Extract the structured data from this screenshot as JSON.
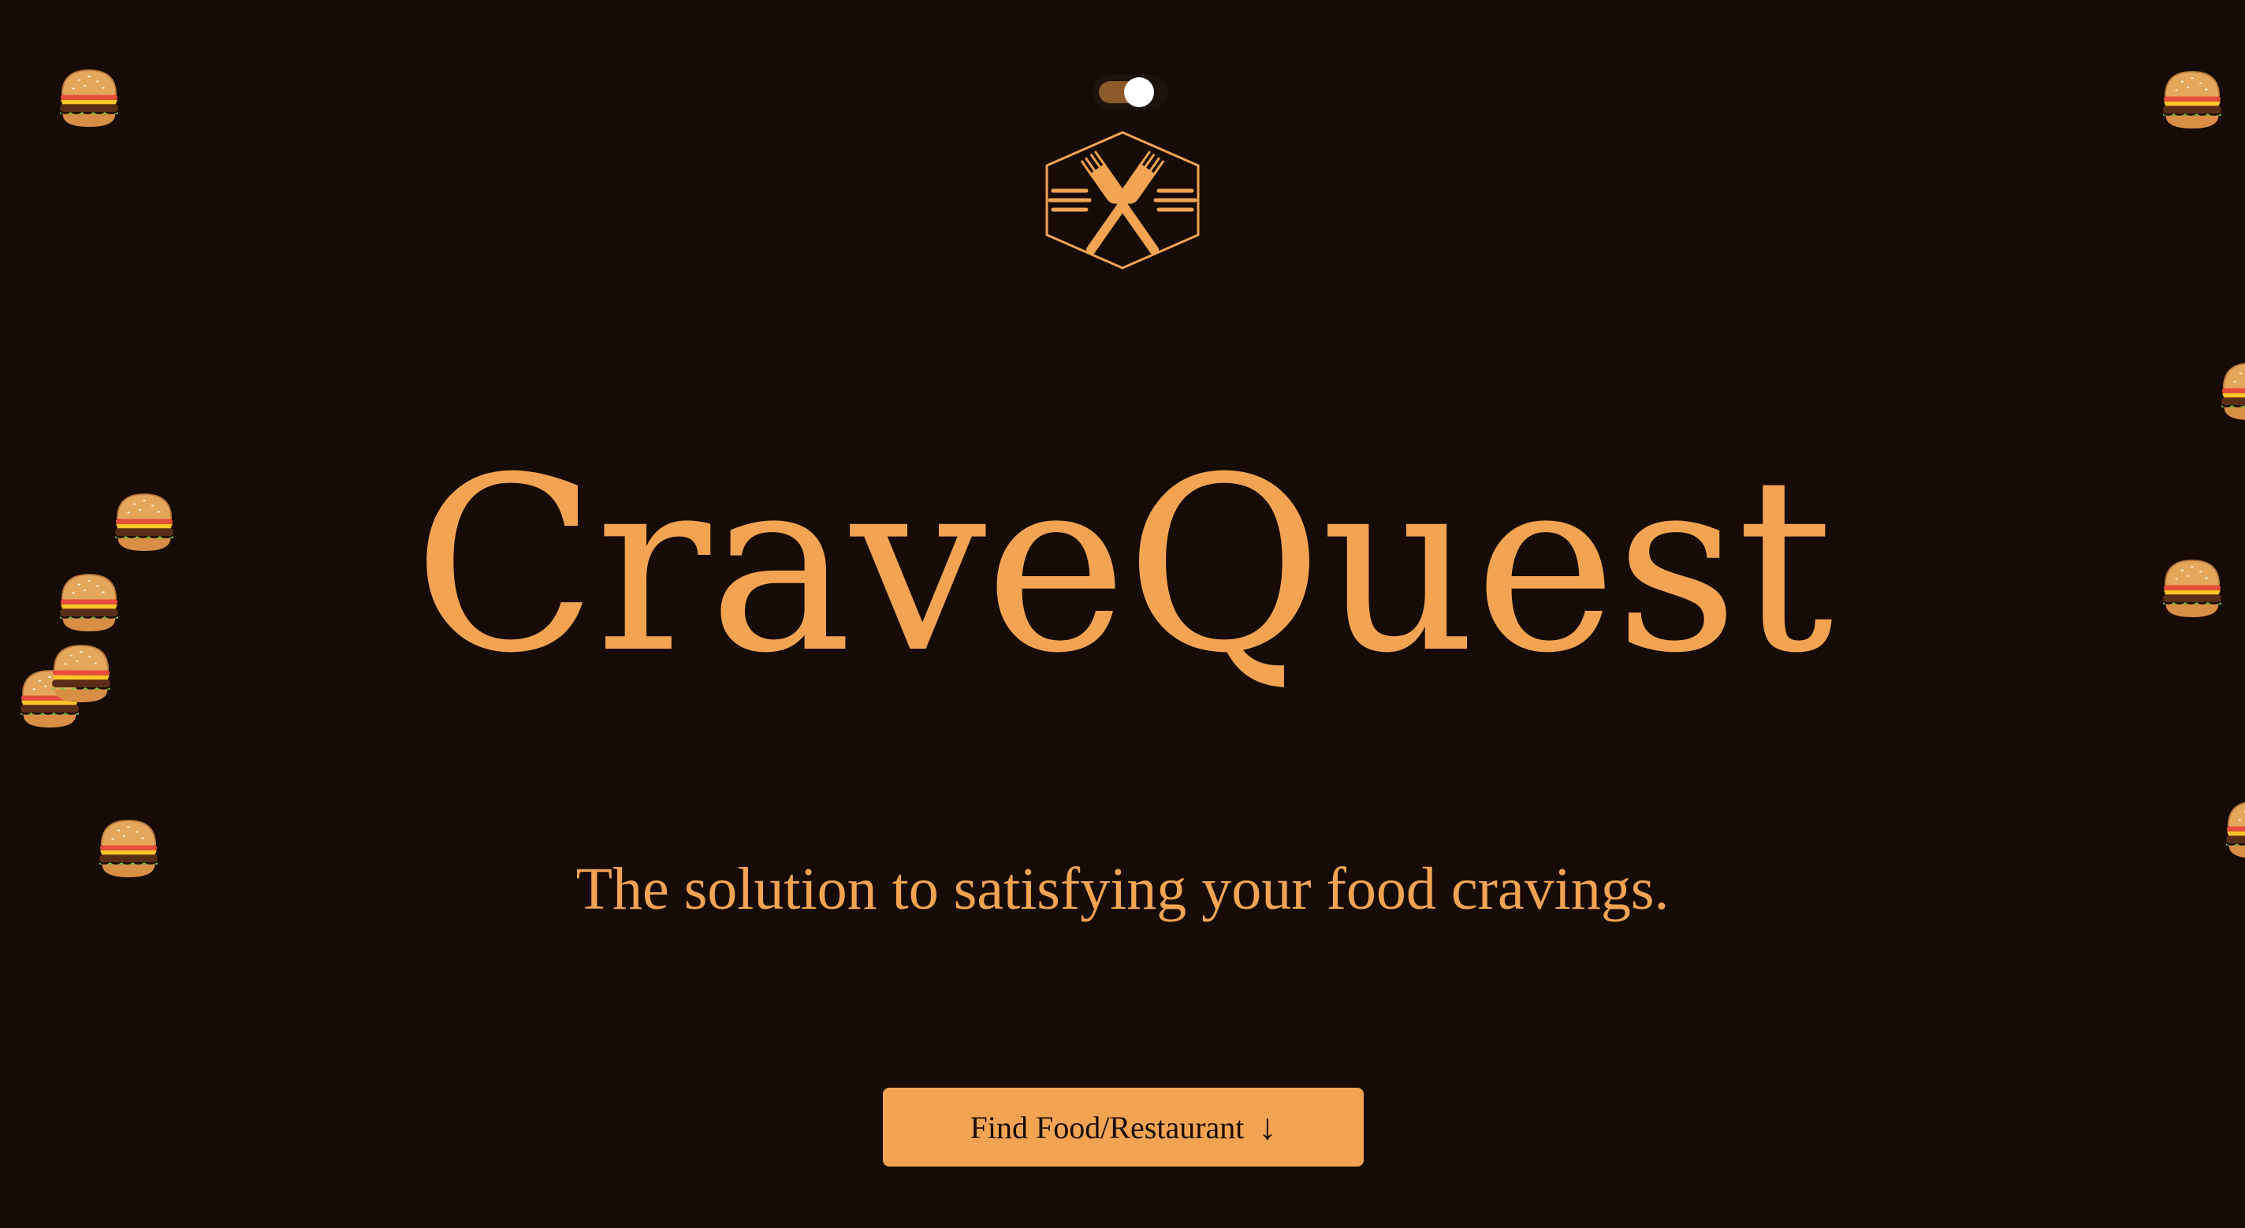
{
  "brand": {
    "title": "CraveQuest",
    "tagline": "The solution to satisfying your food cravings."
  },
  "theme_toggle": {
    "state": "on"
  },
  "cta": {
    "label": "Find Food/Restaurant",
    "icon": "↓"
  },
  "decorations": {
    "icon": "burger-emoji"
  },
  "colors": {
    "background": "#170b05",
    "accent": "#f2a452"
  }
}
